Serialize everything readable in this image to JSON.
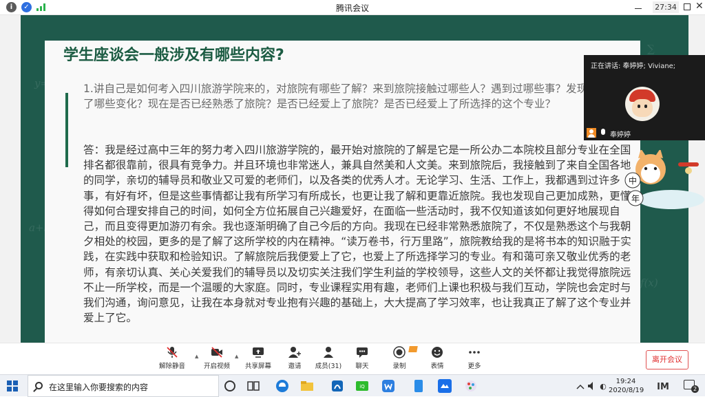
{
  "window": {
    "title": "腾讯会议",
    "timer": "27:34"
  },
  "slide": {
    "title": "学生座谈会一般涉及有哪些内容?",
    "question": "1.讲自己是如何考入四川旅游学院来的，对旅院有哪些了解？来到旅院接触过哪些人？遇到过哪些事？发现了哪些变化？现在是否已经熟悉了旅院？是否已经爱上了旅院？是否已经爱上了所选择的这个专业？",
    "answer": "答：我是经过高中三年的努力考入四川旅游学院的，最开始对旅院的了解是它是一所公办二本院校且部分专业在全国排名都很靠前，很具有竞争力。并且环境也非常迷人，兼具自然美和人文美。来到旅院后，我接触到了来自全国各地的同学，亲切的辅导员和敬业又可爱的老师们，以及各类的优秀人才。无论学习、生活、工作上，我都遇到过许多事，有好有坏，但是这些事情都让我有所学习有所成长，也更让我了解和更靠近旅院。我也发现自己更加成熟，更懂得如何合理安排自己的时间，如何全方位拓展自己兴趣爱好，在面临一些活动时，我不仅知道该如何更好地展现自己，而且变得更加游刃有余。我也逐渐明确了自己今后的方向。我现在已经非常熟悉旅院了，不仅是熟悉这个与我朝夕相处的校园，更多的是了解了这所学校的内在精神。“读万卷书，行万里路”，旅院教给我的是将书本的知识融于实践，在实践中获取和检验知识。了解旅院后我便爱上了它，也爱上了所选择学习的专业。有和蔼可亲又敬业优秀的老师，有亲切认真、关心关爱我们的辅导员以及切实关注我们学生利益的学校领导，这些人文的关怀都让我觉得旅院远不止一所学校，而是一个温暖的大家庭。同时，专业课程实用有趣，老师们上课也积极与我们互动，学院也会定时与我们沟通，询问意见，让我在本身就对专业抱有兴趣的基础上，大大提高了学习效率，也让我真正了解了这个专业并爱上了它。"
  },
  "speaker_panel": {
    "speaking_label": "正在讲话: 奉婷婷; Viviane;",
    "name": "奉婷婷"
  },
  "sticker": {
    "char_top": "中",
    "char_bottom": "年"
  },
  "toolbar": {
    "mute_label": "解除静音",
    "video_label": "开启视频",
    "share_label": "共享屏幕",
    "invite_label": "邀请",
    "members_label": "成员(31)",
    "chat_label": "聊天",
    "record_label": "录制",
    "emoji_label": "表情",
    "more_label": "更多",
    "leave_label": "离开会议"
  },
  "taskbar": {
    "search_placeholder": "在这里输入你要搜索的内容",
    "time": "19:24",
    "date": "2020/8/19",
    "notification_count": "2"
  },
  "colors": {
    "board": "#1f5a4c",
    "title_green": "#1c5c43",
    "leave_red": "#e03030"
  }
}
